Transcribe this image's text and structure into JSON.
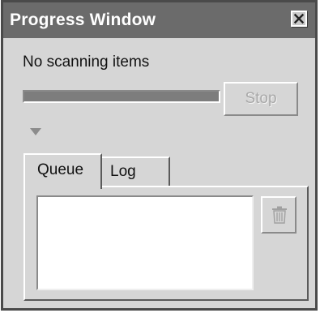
{
  "window": {
    "title": "Progress Window",
    "close_icon": "close-icon"
  },
  "status": {
    "text": "No scanning items",
    "progress_fraction": 1.0,
    "stop_label": "Stop",
    "stop_enabled": false
  },
  "expander": {
    "icon": "triangle-down-icon"
  },
  "tabs": [
    {
      "label": "Queue",
      "selected": true
    },
    {
      "label": "Log",
      "selected": false
    }
  ],
  "queue": {
    "items": [],
    "delete_icon": "trash-icon",
    "delete_enabled": false
  },
  "colors": {
    "titlebar": "#6b6b6b",
    "window_face": "#d6d6d6",
    "progress_fill": "#7d7d7d",
    "disabled_text": "#a8a8a8"
  }
}
